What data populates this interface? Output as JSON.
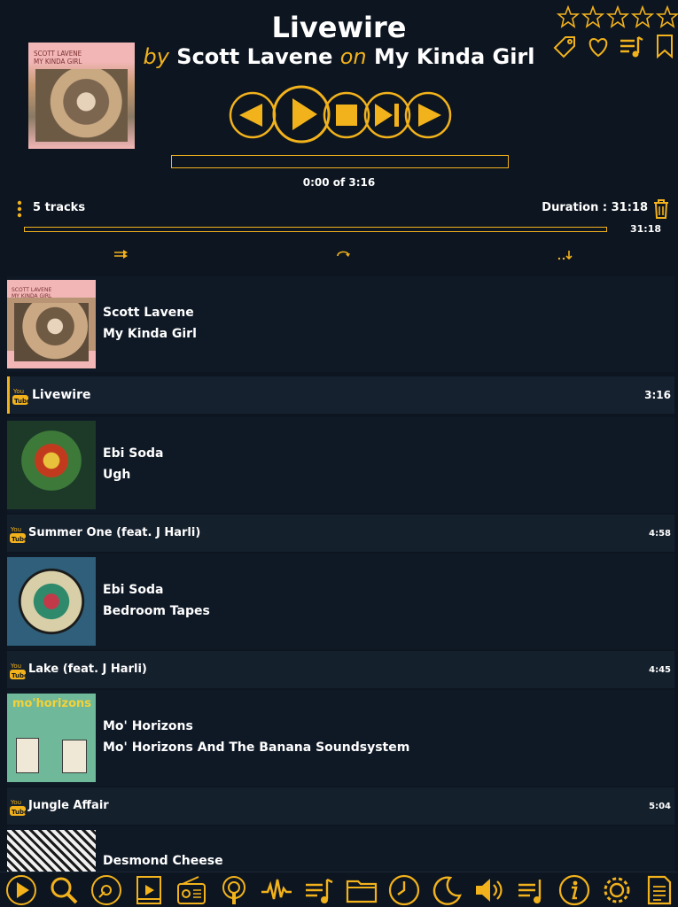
{
  "colors": {
    "accent": "#f2b21c",
    "background": "#0d1520",
    "row": "#15202d"
  },
  "now_playing": {
    "title": "Livewire",
    "by_word": "by",
    "artist": "Scott Lavene",
    "on_word": "on",
    "album": "My Kinda Girl",
    "cover_text": "SCOTT LAVENE\nMY KINDA GIRL",
    "time_text": "0:00 of 3:16",
    "progress": 0,
    "rating_stars": 0,
    "rating_max": 5
  },
  "header_icons": [
    "tag-icon",
    "heart-icon",
    "add-to-playlist-icon",
    "bookmark-icon"
  ],
  "transport": [
    "previous-icon",
    "play-icon",
    "stop-icon",
    "next-icon",
    "forward-icon"
  ],
  "playlist_info": {
    "tracks_label": "5 tracks",
    "duration_label": "Duration : 31:18",
    "overall_time": "31:18",
    "overall_progress": 0
  },
  "modes": [
    "shuffle-icon",
    "repeat-icon",
    "sort-icon"
  ],
  "playlist": [
    {
      "artist": "Scott Lavene",
      "album": "My Kinda Girl",
      "track": "Livewire",
      "time": "3:16",
      "source": "youtube",
      "active": true
    },
    {
      "artist": "Ebi Soda",
      "album": "Ugh",
      "track": "Summer One (feat. J Harli)",
      "time": "4:58",
      "source": "youtube",
      "active": false
    },
    {
      "artist": "Ebi Soda",
      "album": "Bedroom Tapes",
      "track": "Lake (feat. J Harli)",
      "time": "4:45",
      "source": "youtube",
      "active": false
    },
    {
      "artist": "Mo' Horizons",
      "album": "Mo' Horizons And The Banana Soundsystem",
      "track": "Jungle Affair",
      "time": "5:04",
      "source": "youtube",
      "active": false
    },
    {
      "artist": "Desmond Cheese",
      "album": "",
      "track": "",
      "time": "",
      "source": "youtube",
      "active": false
    }
  ],
  "art_texts": {
    "mo_horizons": "mo'horizons"
  },
  "bottom_nav": [
    "now-playing-tab-icon",
    "search-tab-icon",
    "library-tab-icon",
    "videos-tab-icon",
    "radio-tab-icon",
    "podcasts-tab-icon",
    "equalizer-tab-icon",
    "playlists-tab-icon",
    "folders-tab-icon",
    "history-tab-icon",
    "sleep-timer-tab-icon",
    "volume-tab-icon",
    "queue-tab-icon",
    "info-tab-icon",
    "settings-tab-icon",
    "lyrics-tab-icon"
  ]
}
